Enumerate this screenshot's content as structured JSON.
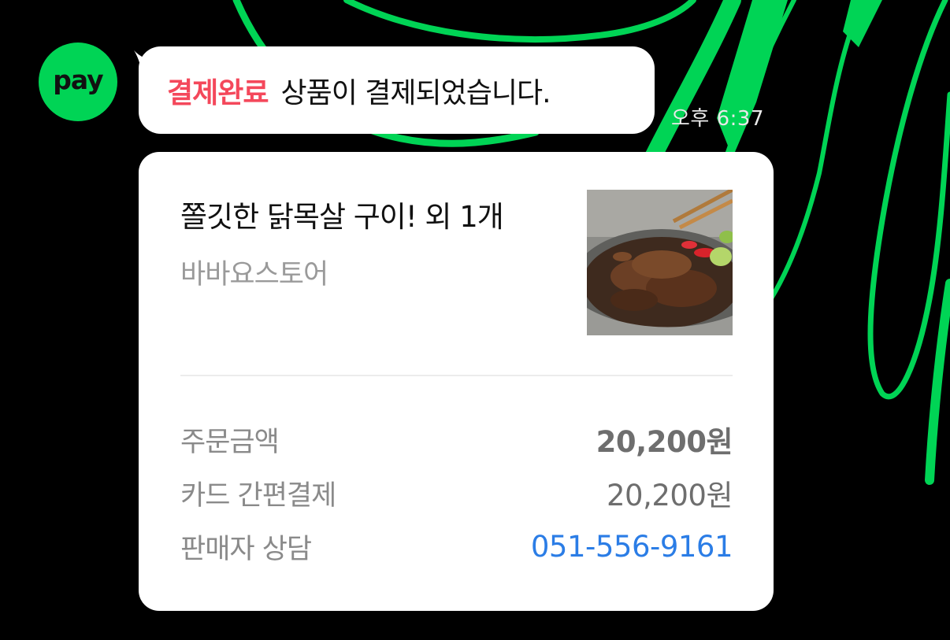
{
  "avatar": {
    "label": "pay"
  },
  "notice": {
    "status_label": "결제완료",
    "message": "상품이 결제되었습니다.",
    "time": "오후 6:37"
  },
  "order": {
    "product_name": "쫄깃한 닭목살 구이! 외 1개",
    "store_name": "바바요스토어",
    "thumbnail_icon": "food-image",
    "rows": [
      {
        "label": "주문금액",
        "value": "20,200원"
      },
      {
        "label": "카드 간편결제",
        "value": "20,200원"
      },
      {
        "label": "판매자 상담",
        "value": "051-556-9161"
      }
    ]
  },
  "colors": {
    "background": "#000000",
    "brand_green": "#00d455",
    "status_red": "#f4485b",
    "link_blue": "#2b7de6"
  }
}
